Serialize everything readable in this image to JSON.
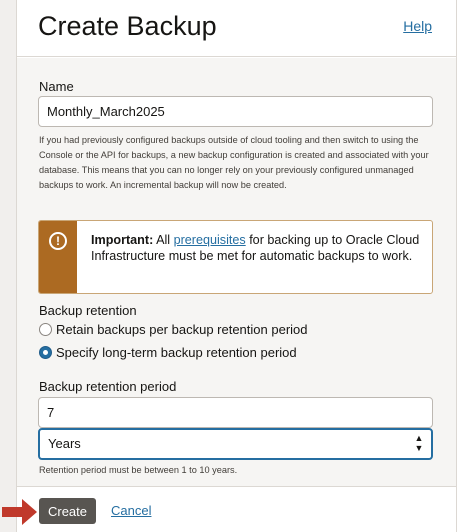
{
  "header": {
    "title": "Create Backup",
    "help_label": "Help"
  },
  "name_field": {
    "label": "Name",
    "value": "Monthly_March2025",
    "help_text": "If you had previously configured backups outside of cloud tooling and then switch to using the Console or the API for backups, a new backup configuration is created and associated with your database. This means that you can no longer rely on your previously configured unmanaged backups to work. An incremental backup will now be created."
  },
  "notice": {
    "icon": "exclamation-circle-icon",
    "bold_prefix": "Important:",
    "text_before_link": "All",
    "link_text": "prerequisites",
    "text_after_link": "for backing up to Oracle Cloud Infrastructure must be met for automatic backups to work.",
    "accent_color": "#ac6a22"
  },
  "retention": {
    "label": "Backup retention",
    "options": [
      {
        "label": "Retain backups per backup retention period",
        "selected": false
      },
      {
        "label": "Specify long-term backup retention period",
        "selected": true
      }
    ]
  },
  "retention_period": {
    "label": "Backup retention period",
    "value": "7",
    "unit_selected": "Years",
    "help_text": "Retention period must be between 1 to 10 years."
  },
  "footer": {
    "create_label": "Create",
    "cancel_label": "Cancel"
  },
  "colors": {
    "link": "#256ea1",
    "primary_button": "#585551",
    "pointer_arrow": "#c0392b"
  }
}
